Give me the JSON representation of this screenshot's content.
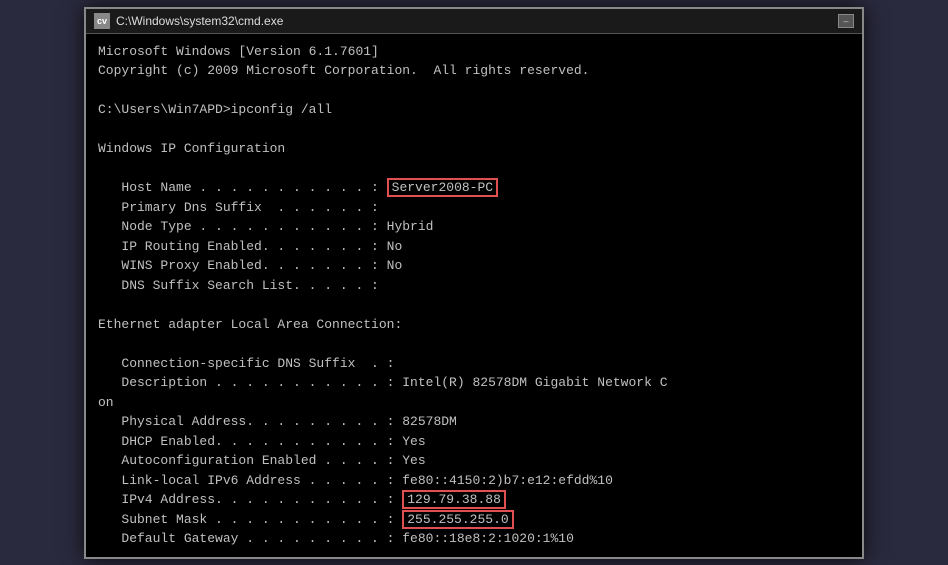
{
  "window": {
    "title": "C:\\Windows\\system32\\cmd.exe",
    "icon_label": "cv"
  },
  "console": {
    "lines": [
      {
        "id": "version",
        "text": "Microsoft Windows [Version 6.1.7601]",
        "indent": 0
      },
      {
        "id": "copyright",
        "text": "Copyright (c) 2009 Microsoft Corporation.  All rights reserved.",
        "indent": 0
      },
      {
        "id": "blank1",
        "text": "",
        "indent": 0
      },
      {
        "id": "prompt",
        "text": "C:\\Users\\Win7APD>ipconfig /all",
        "indent": 0
      },
      {
        "id": "blank2",
        "text": "",
        "indent": 0
      },
      {
        "id": "wip",
        "text": "Windows IP Configuration",
        "indent": 0
      },
      {
        "id": "blank3",
        "text": "",
        "indent": 0
      }
    ],
    "ip_config": {
      "host_name_label": "   Host Name . . . . . . . . . . . : ",
      "host_name_value": "Server2008-PC",
      "primary_dns_label": "   Primary Dns Suffix  . . . . . . : ",
      "primary_dns_value": "",
      "node_type_label": "   Node Type . . . . . . . . . . . : ",
      "node_type_value": "Hybrid",
      "ip_routing_label": "   IP Routing Enabled. . . . . . . : ",
      "ip_routing_value": "No",
      "wins_proxy_label": "   WINS Proxy Enabled. . . . . . . : ",
      "wins_proxy_value": "No",
      "dns_suffix_label": "   DNS Suffix Search List. . . . . : ",
      "dns_suffix_value": ""
    },
    "ethernet": {
      "header": "Ethernet adapter Local Area Connection:",
      "conn_dns_label": "   Connection-specific DNS Suffix  . : ",
      "conn_dns_value": "",
      "desc_label": "   Description . . . . . . . . . . . : ",
      "desc_value": "Intel(R) 82578DM Gigabit Network C",
      "desc_cont": "on",
      "physical_label": "   Physical Address. . . . . . . . . : ",
      "physical_value": "82578DM",
      "dhcp_label": "   DHCP Enabled. . . . . . . . . . . : ",
      "dhcp_value": "Yes",
      "autoconfig_label": "   Autoconfiguration Enabled . . . . : ",
      "autoconfig_value": "Yes",
      "ipv6_label": "   Link-local IPv6 Address . . . . . : ",
      "ipv6_value": "fe80::4150:2)b7:e12:efdd%10",
      "ipv4_label": "   IPv4 Address. . . . . . . . . . . : ",
      "ipv4_value": "129.79.38.88",
      "subnet_label": "   Subnet Mask . . . . . . . . . . . : ",
      "subnet_value": "255.255.255.0",
      "gateway_label": "   Default Gateway . . . . . . . . . : ",
      "gateway_value": "fe80::18e8:2:1020:1%10"
    }
  },
  "colors": {
    "highlight_border": "#e05050",
    "text": "#c0c0c0",
    "background": "#000000"
  }
}
